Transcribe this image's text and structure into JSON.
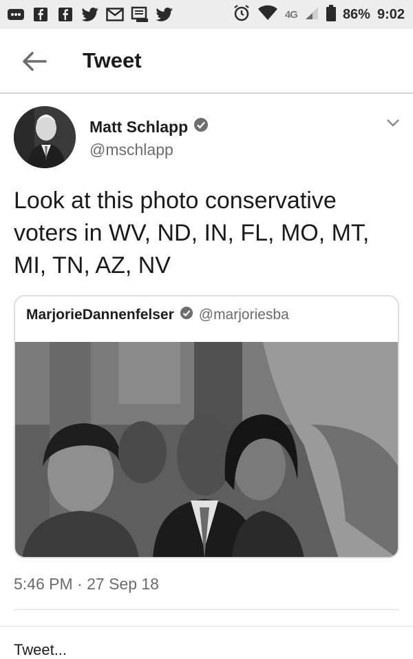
{
  "status_bar": {
    "network": "4G",
    "battery": "86%",
    "time": "9:02",
    "icons": [
      "more-icon",
      "facebook-icon",
      "facebook-icon",
      "twitter-icon",
      "gmail-icon",
      "messages-icon",
      "twitter-icon",
      "alarm-icon",
      "wifi-icon",
      "signal-icon",
      "battery-icon"
    ]
  },
  "header": {
    "title": "Tweet"
  },
  "tweet": {
    "author_name": "Matt Schlapp",
    "author_handle": "@mschlapp",
    "text": "Look at this photo conservative voters in WV, ND, IN, FL, MO, MT, MI, TN, AZ, NV",
    "timestamp": "5:46 PM · 27 Sep 18"
  },
  "quoted_tweet": {
    "author_name": "MarjorieDannenfelser",
    "author_handle": "@marjoriesba"
  },
  "footer": {
    "partial_text": "Tweet..."
  }
}
